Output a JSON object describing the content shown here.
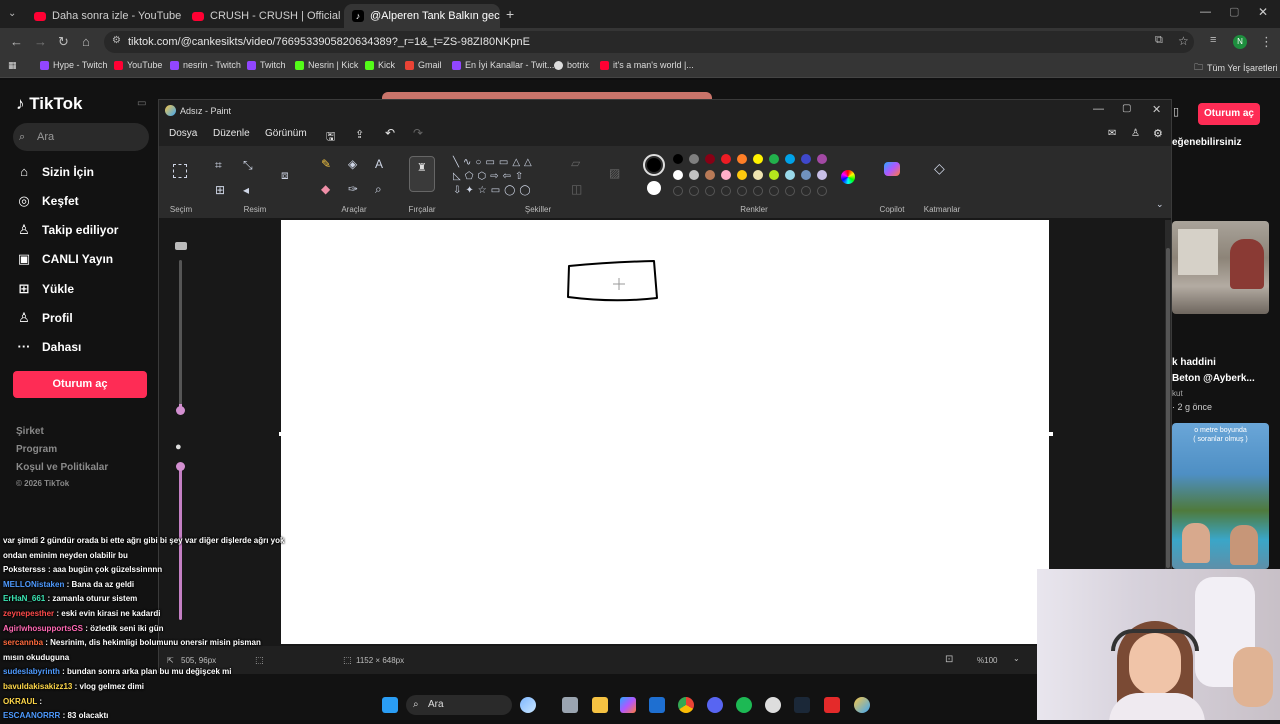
{
  "browser": {
    "tabs": [
      {
        "title": "Daha sonra izle - YouTube",
        "icon": "youtube-icon"
      },
      {
        "title": "CRUSH - CRUSH | Official Musi",
        "icon": "youtube-icon"
      },
      {
        "title": "@Alperen Tank Balkın gece iç |",
        "icon": "tiktok-icon"
      }
    ],
    "url": "tiktok.com/@cankesikts/video/7669533905820634389?_r=1&_t=ZS-98ZI80NKpnE",
    "profile_initial": "N",
    "bookmarks": [
      {
        "label": "Hype - Twitch",
        "color": "#9146ff"
      },
      {
        "label": "YouTube",
        "color": "#ff0033"
      },
      {
        "label": "nesrin - Twitch",
        "color": "#9146ff"
      },
      {
        "label": "Twitch",
        "color": "#9146ff"
      },
      {
        "label": "Nesrin | Kick",
        "color": "#53fc18"
      },
      {
        "label": "Kick",
        "color": "#53fc18"
      },
      {
        "label": "Gmail",
        "color": "#ea4335"
      },
      {
        "label": "En İyi Kanallar - Twit...",
        "color": "#9146ff"
      },
      {
        "label": "botrix",
        "color": "#dddddd"
      },
      {
        "label": "it's a man's world |...",
        "color": "#ff0033"
      }
    ],
    "all_bookmarks": "Tüm Yer İşaretleri"
  },
  "tiktok": {
    "logo": "TikTok",
    "search_placeholder": "Ara",
    "nav": [
      {
        "label": "Sizin İçin",
        "icon": "home-icon"
      },
      {
        "label": "Keşfet",
        "icon": "compass-icon"
      },
      {
        "label": "Takip ediliyor",
        "icon": "following-icon"
      },
      {
        "label": "CANLI Yayın",
        "icon": "live-icon"
      },
      {
        "label": "Yükle",
        "icon": "upload-icon"
      },
      {
        "label": "Profil",
        "icon": "profile-icon"
      },
      {
        "label": "Dahası",
        "icon": "more-icon"
      }
    ],
    "login": "Oturum aç",
    "footer": [
      "Şirket",
      "Program",
      "Koşul ve Politikalar",
      "© 2026 TikTok"
    ],
    "right": {
      "header_partial": "eğenebilirsiniz",
      "item1_title": "k haddini",
      "item1_author": "Beton @Ayberk...",
      "item1_extra": "kut",
      "item1_time": "2 g önce",
      "item2_caption": "( soranlar olmuş )",
      "item2_partial": "o metre boyunda"
    }
  },
  "paint": {
    "title": "Adsız - Paint",
    "menu": [
      "Dosya",
      "Düzenle",
      "Görünüm"
    ],
    "groups": [
      "Seçim",
      "Resim",
      "Araçlar",
      "Fırçalar",
      "Şekiller",
      "Renkler",
      "Copilot",
      "Katmanlar"
    ],
    "colors_row1": [
      "#000000",
      "#7f7f7f",
      "#880015",
      "#ed1c24",
      "#ff7f27",
      "#fff200",
      "#22b14c",
      "#00a2e8",
      "#3f48cc",
      "#a349a4"
    ],
    "colors_row2": [
      "#ffffff",
      "#c3c3c3",
      "#b97a57",
      "#ffaec9",
      "#ffc90e",
      "#efe4b0",
      "#b5e61d",
      "#99d9ea",
      "#7092be",
      "#c8bfe7"
    ],
    "primary_color": "#000000",
    "secondary_color": "#ffffff",
    "cursor_pos": "505, 96px",
    "canvas_size": "1152 × 648px",
    "zoom": "%100"
  },
  "chat": [
    {
      "user": "",
      "color": "#ffffff",
      "text": "var şimdi 2 gündür orada bi ette ağrı gibi bi şey var diğer dişlerde ağrı yok"
    },
    {
      "user": "",
      "color": "#ffffff",
      "text": "ondan eminim neyden olabilir bu"
    },
    {
      "user": "Pokstersss",
      "color": "#ffffff",
      "text": ": aaa bugün çok güzelssinnnn"
    },
    {
      "user": "MELLONistaken",
      "color": "#4f9bff",
      "text": ": Bana da az geldi"
    },
    {
      "user": "ErHaN_661",
      "color": "#3ce6b4",
      "text": ": zamanla oturur sistem"
    },
    {
      "user": "zeynepesther",
      "color": "#ff4b4b",
      "text": ": eski evin kirasi ne kadardi"
    },
    {
      "user": "AgirlwhosupportsGS",
      "color": "#ff69b4",
      "text": ": özledik seni iki gün"
    },
    {
      "user": "sercannba",
      "color": "#ff6a3d",
      "text": ": Nesrinim, dis hekimligi bolumunu onersir misin pisman"
    },
    {
      "user": "",
      "color": "#ffffff",
      "text": "mısın okuduguna"
    },
    {
      "user": "sudeslabyrinth",
      "color": "#4f9bff",
      "text": ": bundan sonra arka plan bu mu değişcek mi"
    },
    {
      "user": "bavuldakisakizz13",
      "color": "#ffd84a",
      "text": ": vlog gelmez dimi"
    },
    {
      "user": "OKRAUL",
      "color": "#ffd84a",
      "text": ":"
    },
    {
      "user": "ESCAANORRR",
      "color": "#4f9bff",
      "text": ": 83 olacaktı"
    }
  ],
  "taskbar": {
    "search": "Ara"
  }
}
